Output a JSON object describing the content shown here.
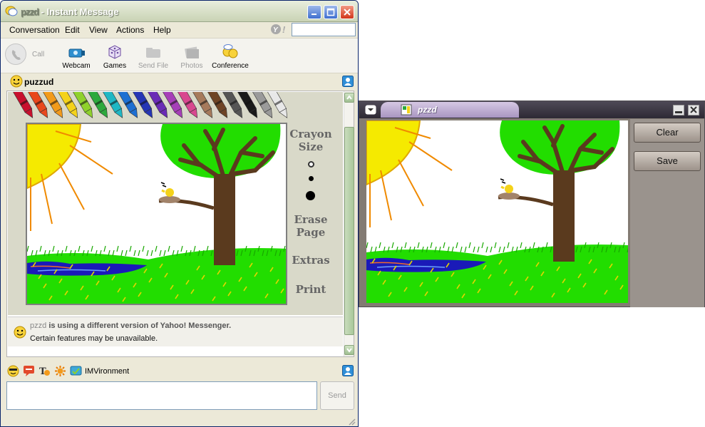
{
  "im": {
    "title_suffix": "- Instant Message",
    "title_scribble": "pzzd",
    "menu": [
      "Conversation",
      "Edit",
      "View",
      "Actions",
      "Help"
    ],
    "toolbar": {
      "call": "Call",
      "webcam": "Webcam",
      "games": "Games",
      "send_file": "Send File",
      "photos": "Photos",
      "conference": "Conference"
    },
    "contact_name": "puzzud",
    "doodle_labels": {
      "crayon": "Crayon",
      "size": "Size",
      "erase": "Erase",
      "page": "Page",
      "extras": "Extras",
      "print": "Print"
    },
    "notice": {
      "scribble": "pzzd",
      "line1": "is using a different version of Yahoo! Messenger.",
      "line2": "Certain features may be unavailable."
    },
    "imvironment_label": "IMVironment",
    "send_label": "Send"
  },
  "popup": {
    "title": "pzzd",
    "clear_label": "Clear",
    "save_label": "Save"
  },
  "colors": {
    "xp_blue": "#3f6fd0",
    "close_red": "#d2361a",
    "popup_frame": "#837b73",
    "grass": "#22dd00",
    "water": "#1a1ab8",
    "tree_trunk": "#5a3a1e",
    "sun": "#f5ea00"
  },
  "crayon_colors": [
    "#c8102e",
    "#e8471c",
    "#f29a1b",
    "#f4d21a",
    "#8fd12c",
    "#2ca93d",
    "#1fb7c4",
    "#1d6fd2",
    "#2535b5",
    "#6a2bb6",
    "#a63fb8",
    "#d8488f",
    "#a67a5c",
    "#6e4426",
    "#555555",
    "#1a1a1a",
    "#9a9a9a",
    "#e8e8e8"
  ]
}
